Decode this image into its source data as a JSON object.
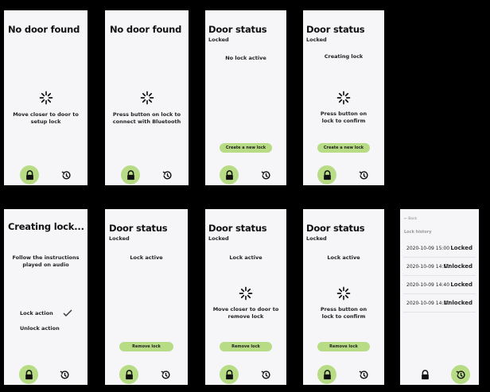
{
  "screens": {
    "s1": {
      "title": "No door found",
      "message": [
        "Move closer to door to",
        "setup lock"
      ]
    },
    "s2": {
      "title": "No door found",
      "message": [
        "Press button on lock to",
        "connect with Bluetooth"
      ]
    },
    "s3": {
      "title": "Door status",
      "subtitle": "Locked",
      "status": "No lock active",
      "button": "Create a new lock"
    },
    "s4": {
      "title": "Door status",
      "subtitle": "Locked",
      "status": "Creating lock",
      "message": [
        "Press button on",
        "lock to confirm"
      ],
      "button": "Create a new lock"
    },
    "s5": {
      "title": "Creating lock...",
      "message": [
        "Follow the instructions",
        "played on audio"
      ],
      "actions": [
        "Lock action",
        "Unlock action"
      ]
    },
    "s6": {
      "title": "Door status",
      "subtitle": "Locked",
      "status": "Lock active",
      "button": "Remove lock"
    },
    "s7": {
      "title": "Door status",
      "subtitle": "Locked",
      "status": "Lock active",
      "message": [
        "Move closer to door to",
        "remove lock"
      ],
      "button": "Remove lock"
    },
    "s8": {
      "title": "Door status",
      "subtitle": "Locked",
      "status": "Lock active",
      "message": [
        "Press button on",
        "lock to confirm"
      ],
      "button": "Remove lock"
    },
    "s9": {
      "back": "← Back",
      "heading": "Lock history",
      "rows": [
        {
          "date": "2020-10-09 15:00",
          "state": "Locked"
        },
        {
          "date": "2020-10-09 14:50",
          "state": "Unlocked"
        },
        {
          "date": "2020-10-09 14:40",
          "state": "Locked"
        },
        {
          "date": "2020-10-09 14:30",
          "state": "Unlocked"
        }
      ]
    }
  },
  "icons": {
    "lock": "lock-icon",
    "history": "history-icon",
    "loading": "spinner-icon",
    "check": "checkmark-icon"
  },
  "colors": {
    "accent": "#b8dc85",
    "screen_bg": "#f6f6f9",
    "background": "#000000"
  }
}
